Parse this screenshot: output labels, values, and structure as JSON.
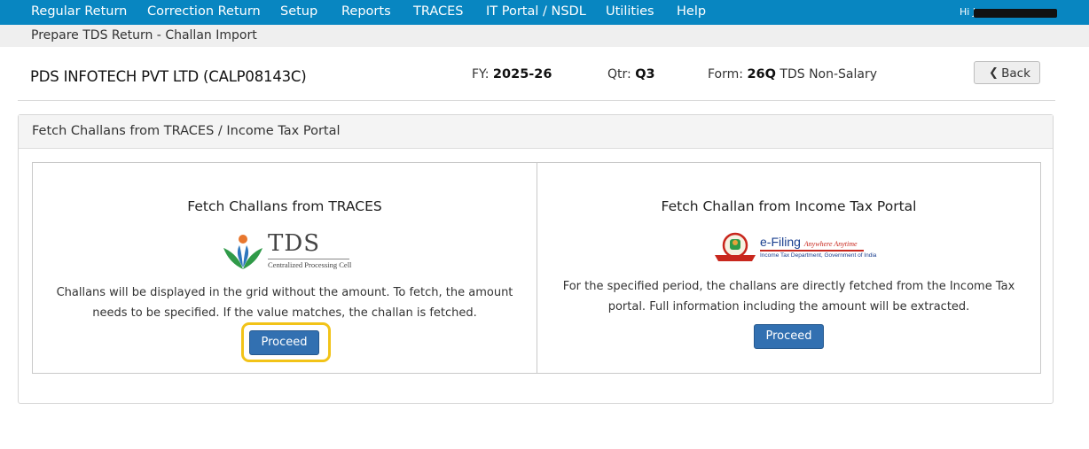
{
  "nav": {
    "items": [
      "Regular Return",
      "Correction Return",
      "Setup",
      "Reports",
      "TRACES",
      "IT Portal / NSDL",
      "Utilities",
      "Help"
    ],
    "greeting": "Hi J",
    "nav_bg": "#0886c1"
  },
  "breadcrumb": "Prepare TDS Return - Challan Import",
  "header": {
    "company": "PDS INFOTECH PVT LTD (CALP08143C)",
    "fy_label": "FY:",
    "fy_value": "2025-26",
    "qtr_label": "Qtr:",
    "qtr_value": "Q3",
    "form_label": "Form:",
    "form_value": "26Q",
    "form_desc": "TDS Non-Salary",
    "back_label": "Back"
  },
  "panel": {
    "title": "Fetch Challans from TRACES / Income Tax Portal"
  },
  "traces_card": {
    "title": "Fetch Challans from TRACES",
    "logo_word": "TDS",
    "logo_sub": "Centralized Processing Cell",
    "description": "Challans will be displayed in the grid without the amount. To fetch, the amount needs to be specified. If the value matches, the challan is fetched.",
    "button": "Proceed"
  },
  "portal_card": {
    "title": "Fetch Challan from Income Tax Portal",
    "logo_word": "e-Filing",
    "logo_tag": "Anywhere Anytime",
    "logo_sub": "Income Tax Department, Government of India",
    "description": "For the specified period, the challans are directly fetched from the Income Tax portal. Full information including the amount will be extracted.",
    "button": "Proceed"
  },
  "colors": {
    "button_blue": "#3270b1",
    "highlight": "#f2c318"
  }
}
